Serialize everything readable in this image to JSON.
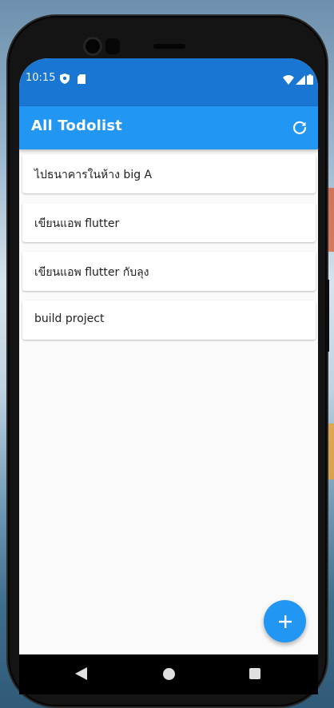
{
  "status_bar": {
    "time": "10:15",
    "left_icons": [
      "shield-icon",
      "sd-card-icon"
    ],
    "right_icons": [
      "wifi-icon",
      "signal-icon",
      "battery-icon"
    ]
  },
  "app_bar": {
    "title": "All Todolist",
    "action_icon": "refresh-icon",
    "color": "#2196f3",
    "status_color": "#1976d2"
  },
  "todos": [
    {
      "text": "ไปธนาคารในห้าง big A"
    },
    {
      "text": "เขียนแอพ flutter"
    },
    {
      "text": "เขียนแอพ flutter กับลุง"
    },
    {
      "text": "build project"
    }
  ],
  "fab": {
    "icon": "plus-icon",
    "label": "+"
  },
  "nav_bar": {
    "icons": [
      "back-icon",
      "home-icon",
      "recents-icon"
    ]
  }
}
